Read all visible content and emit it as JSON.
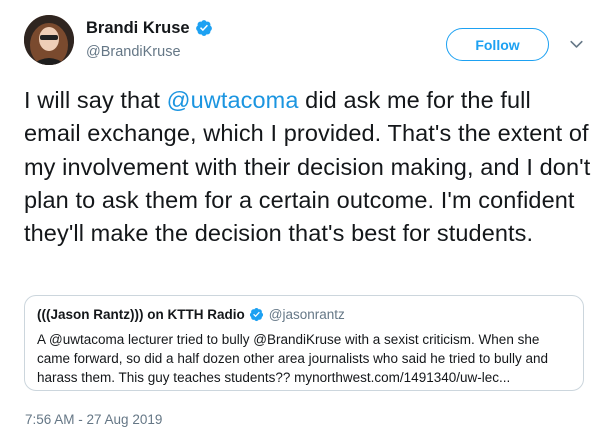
{
  "author": {
    "display_name": "Brandi Kruse",
    "handle": "@BrandiKruse",
    "avatar_icon": "profile-photo",
    "verified_icon": "verified-badge-icon"
  },
  "actions": {
    "follow_label": "Follow",
    "menu_icon": "chevron-down-icon"
  },
  "tweet": {
    "text_before_mention": "I will say that ",
    "mention": "@uwtacoma",
    "text_after_mention": " did ask me for the full email exchange, which I provided. That's the extent of my involvement with their decision making, and I don't plan to ask them for a certain outcome. I'm confident they'll make the decision that's best for students."
  },
  "quoted_tweet": {
    "display_name": "(((Jason Rantz))) on KTTH Radio",
    "handle": "@jasonrantz",
    "text": "A @uwtacoma lecturer tried to bully @BrandiKruse with a sexist criticism. When she came forward, so did a half dozen other area journalists who said he tried to bully and harass them. This guy teaches students?? mynorthwest.com/1491340/uw-lec..."
  },
  "timestamp": "7:56 AM - 27 Aug 2019",
  "colors": {
    "accent": "#1da1f2",
    "mention": "#1b95e0",
    "secondary_text": "#657786",
    "border": "#ccd6dd"
  }
}
